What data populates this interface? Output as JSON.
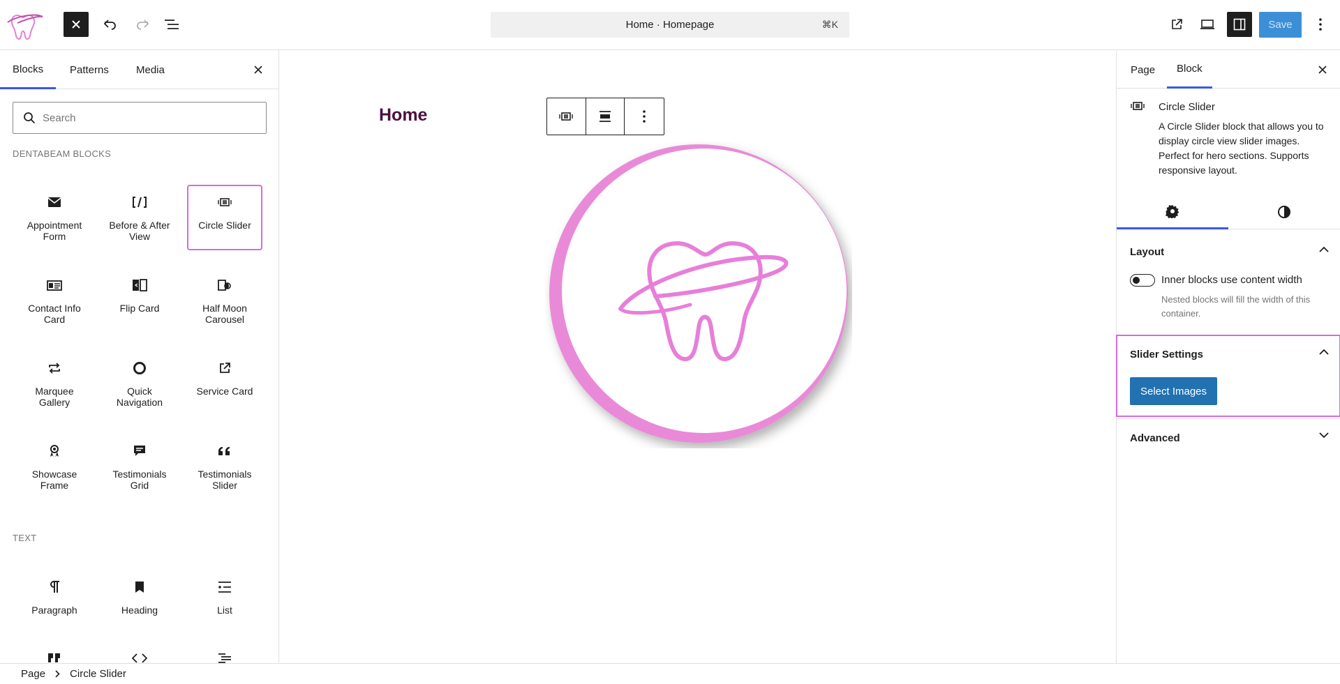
{
  "topbar": {
    "command_bar_text": "Home · Homepage",
    "command_shortcut": "⌘K",
    "save_label": "Save"
  },
  "inserter": {
    "tabs": [
      "Blocks",
      "Patterns",
      "Media"
    ],
    "search_placeholder": "Search",
    "category_dentabeam": "DENTABEAM BLOCKS",
    "dentabeam_blocks": [
      "Appointment Form",
      "Before & After View",
      "Circle Slider",
      "Contact Info Card",
      "Flip Card",
      "Half Moon Carousel",
      "Marquee Gallery",
      "Quick Navigation",
      "Service Card",
      "Showcase Frame",
      "Testimonials Grid",
      "Testimonials Slider"
    ],
    "category_text": "TEXT",
    "text_blocks": [
      "Paragraph",
      "Heading",
      "List"
    ],
    "text_block_icons": [
      "quote-icon",
      "code-icon",
      "details-icon"
    ]
  },
  "canvas": {
    "page_title": "Home"
  },
  "settings": {
    "tabs": [
      "Page",
      "Block"
    ],
    "block_name": "Circle Slider",
    "block_description": "A Circle Slider block that allows you to display circle view slider images. Perfect for hero sections. Supports responsive layout.",
    "layout_title": "Layout",
    "toggle_label": "Inner blocks use content width",
    "toggle_help": "Nested blocks will fill the width of this container.",
    "slider_settings_title": "Slider Settings",
    "select_images_label": "Select Images",
    "advanced_title": "Advanced"
  },
  "breadcrumb": {
    "items": [
      "Page",
      "Circle Slider"
    ]
  },
  "colors": {
    "accent": "#3858e9",
    "highlight": "#d36be0",
    "brand_pink": "#e77fd9",
    "button_blue": "#2271b1"
  }
}
